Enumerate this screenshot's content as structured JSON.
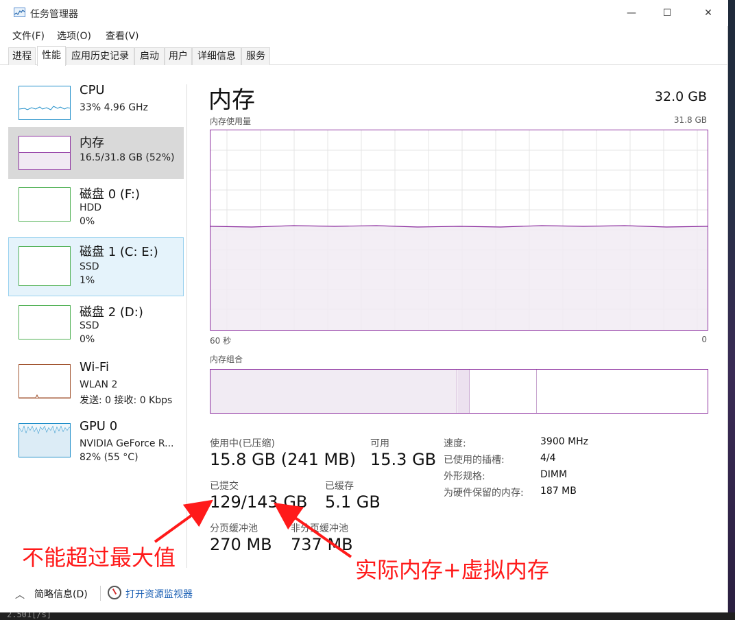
{
  "window": {
    "title": "任务管理器",
    "controls": {
      "minimize": "—",
      "maximize": "☐",
      "close": "✕"
    }
  },
  "menu": [
    "文件(F)",
    "选项(O)",
    "查看(V)"
  ],
  "tabs": [
    "进程",
    "性能",
    "应用历史记录",
    "启动",
    "用户",
    "详细信息",
    "服务"
  ],
  "active_tab": "性能",
  "sidebar": [
    {
      "name": "CPU",
      "sub1": "33% 4.96 GHz",
      "sub2": "",
      "sub3": ""
    },
    {
      "name": "内存",
      "sub1": "16.5/31.8 GB (52%)",
      "sub2": "",
      "sub3": ""
    },
    {
      "name": "磁盘 0 (F:)",
      "sub1": "HDD",
      "sub2": "0%",
      "sub3": ""
    },
    {
      "name": "磁盘 1 (C: E:)",
      "sub1": "SSD",
      "sub2": "1%",
      "sub3": ""
    },
    {
      "name": "磁盘 2 (D:)",
      "sub1": "SSD",
      "sub2": "0%",
      "sub3": ""
    },
    {
      "name": "Wi-Fi",
      "sub1": "WLAN 2",
      "sub2": "发送: 0 接收: 0 Kbps",
      "sub3": ""
    },
    {
      "name": "GPU 0",
      "sub1": "NVIDIA GeForce R...",
      "sub2": "82% (55 °C)",
      "sub3": ""
    }
  ],
  "sidebar_state": {
    "selected": "内存",
    "hover": "磁盘 1 (C: E:)"
  },
  "memory_usage_fraction": 0.52,
  "main": {
    "title": "内存",
    "total": "32.0 GB",
    "usage_label": "内存使用量",
    "usage_max": "31.8 GB",
    "axis_left": "60 秒",
    "axis_right": "0",
    "composition_label": "内存组合"
  },
  "stats": {
    "in_use_label": "使用中(已压缩)",
    "in_use_value": "15.8 GB (241 MB)",
    "available_label": "可用",
    "available_value": "15.3 GB",
    "committed_label": "已提交",
    "committed_value": "129/143 GB",
    "cached_label": "已缓存",
    "cached_value": "5.1 GB",
    "paged_label": "分页缓冲池",
    "paged_value": "270 MB",
    "nonpaged_label": "非分页缓冲池",
    "nonpaged_value": "737 MB"
  },
  "details": [
    {
      "label": "速度:",
      "value": "3900 MHz"
    },
    {
      "label": "已使用的插槽:",
      "value": "4/4"
    },
    {
      "label": "外形规格:",
      "value": "DIMM"
    },
    {
      "label": "为硬件保留的内存:",
      "value": "187 MB"
    }
  ],
  "footer": {
    "brief": "简略信息(D)",
    "monitor_link": "打开资源监视器"
  },
  "annotations": {
    "left": "不能超过最大值",
    "right": "实际内存+虚拟内存"
  },
  "colors": {
    "memory_accent": "#8b2d9e",
    "cpu_accent": "#1f8ec9",
    "disk_accent": "#4caf50",
    "wifi_accent": "#a0522d",
    "annotation": "#ff1a1a",
    "link": "#1a5fb4"
  },
  "background_text": "2.501[/s]"
}
